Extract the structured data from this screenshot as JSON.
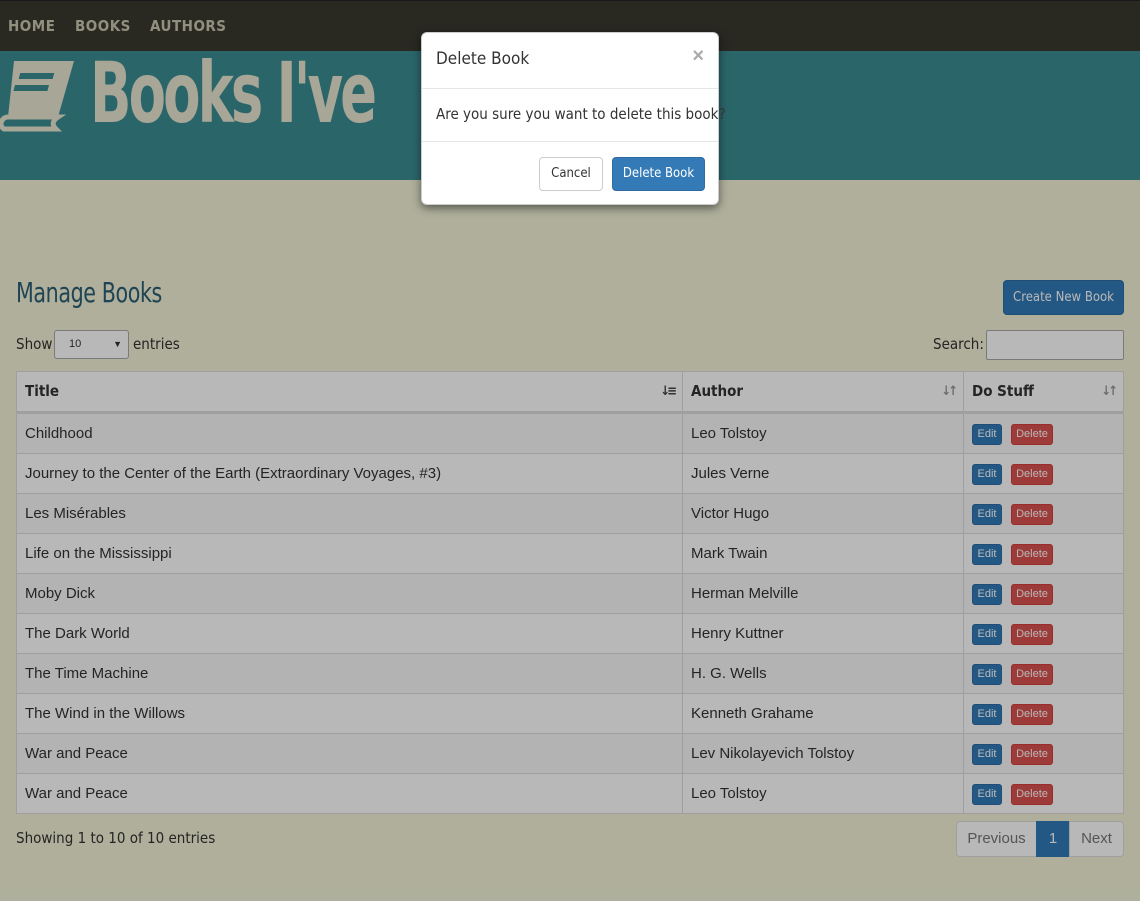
{
  "nav": {
    "items": [
      "HOME",
      "BOOKS",
      "AUTHORS"
    ]
  },
  "header": {
    "title": "Books I've",
    "icon": "book-icon"
  },
  "main": {
    "heading": "Manage Books",
    "create_button": "Create New Book",
    "show_label": "Show",
    "page_size": "10",
    "entries_label": "entries",
    "search_label": "Search:",
    "search_value": ""
  },
  "table": {
    "columns": [
      "Title",
      "Author",
      "Do Stuff"
    ],
    "edit_label": "Edit",
    "delete_label": "Delete",
    "rows": [
      {
        "title": "Childhood",
        "author": "Leo Tolstoy"
      },
      {
        "title": "Journey to the Center of the Earth (Extraordinary Voyages, #3)",
        "author": "Jules Verne"
      },
      {
        "title": "Les Misérables",
        "author": "Victor Hugo"
      },
      {
        "title": "Life on the Mississippi",
        "author": "Mark Twain"
      },
      {
        "title": "Moby Dick",
        "author": "Herman Melville"
      },
      {
        "title": "The Dark World",
        "author": "Henry Kuttner"
      },
      {
        "title": "The Time Machine",
        "author": "H. G. Wells"
      },
      {
        "title": "The Wind in the Willows",
        "author": "Kenneth Grahame"
      },
      {
        "title": "War and Peace",
        "author": "Lev Nikolayevich Tolstoy"
      },
      {
        "title": "War and Peace",
        "author": "Leo Tolstoy"
      }
    ]
  },
  "footer": {
    "info": "Showing 1 to 10 of 10 entries",
    "previous": "Previous",
    "current_page": "1",
    "next": "Next"
  },
  "modal": {
    "title": "Delete Book",
    "close_symbol": "×",
    "body": "Are you sure you want to delete this book?",
    "cancel": "Cancel",
    "confirm": "Delete Book"
  },
  "colors": {
    "navbar": "#3a3a30",
    "header": "#3b8c94",
    "page_bg": "#f3f3d9",
    "primary": "#337ab7",
    "danger": "#d9534f"
  }
}
